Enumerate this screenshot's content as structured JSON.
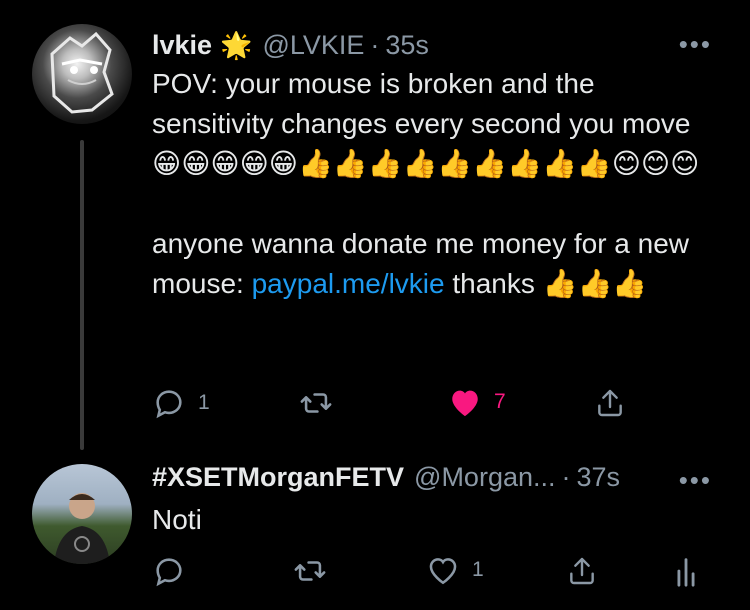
{
  "tweet1": {
    "name": "lvkie",
    "badge_emoji": "🌟",
    "handle": "@LVKIE",
    "dot": "·",
    "time": "35s",
    "more": "•••",
    "text_before_link": "POV: your mouse is broken and the sensitivity changes every second you move 😁😁😁😁😁👍👍👍👍👍👍👍👍👍😊😊😊\n\nanyone wanna donate me money for a new mouse: ",
    "link": "paypal.me/lvkie",
    "text_after_link": " thanks 👍👍👍",
    "reply_count": "1",
    "retweet_count": "",
    "like_count": "7",
    "liked": true
  },
  "tweet2": {
    "name": "#XSETMorganFETV",
    "handle": "@Morgan...",
    "dot": "·",
    "time": "37s",
    "more": "•••",
    "text": "Noti",
    "reply_count": "",
    "retweet_count": "",
    "like_count": "1"
  },
  "colors": {
    "background": "#000000",
    "text": "#e7e9ea",
    "muted": "#8b98a5",
    "link": "#1d9bf0",
    "like": "#f91880"
  },
  "icons": {
    "reply": "reply-icon",
    "retweet": "retweet-icon",
    "like": "heart-icon",
    "share": "share-icon",
    "analytics": "analytics-icon"
  }
}
